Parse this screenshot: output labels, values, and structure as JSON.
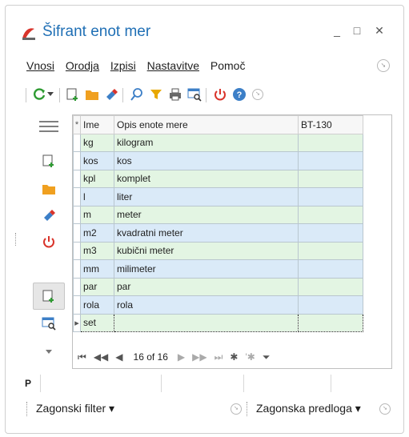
{
  "window": {
    "title": "Šifrant enot mer",
    "minimize": "_",
    "maximize": "□",
    "close": "✕"
  },
  "menu": {
    "items": [
      "Vnosi",
      "Orodja",
      "Izpisi",
      "Nastavitve",
      "Pomoč"
    ]
  },
  "toolbar": {
    "icons": [
      "refresh-icon",
      "dropdown-arrow-icon",
      "new-document-icon",
      "open-folder-icon",
      "eraser-icon",
      "search-icon",
      "filter-icon",
      "print-icon",
      "table-search-icon",
      "power-icon",
      "help-icon",
      "overflow-icon"
    ],
    "colors": {
      "green": "#2e9b32",
      "orange": "#f0a020",
      "red": "#d9342b",
      "blue": "#3c7fc7",
      "yellow": "#e8a800"
    }
  },
  "sidebar": {
    "icons": [
      "hamburger-icon",
      "new-record-icon",
      "open-folder-icon",
      "eraser-icon",
      "power-icon",
      "new-record-selected-icon",
      "table-search-icon",
      "collapse-arrow-icon"
    ]
  },
  "grid": {
    "columns": [
      "Ime",
      "Opis enote mere",
      "BT-130"
    ],
    "header_marker": "*",
    "rows": [
      {
        "ime": "kg",
        "opis": "kilogram",
        "bt": ""
      },
      {
        "ime": "kos",
        "opis": "kos",
        "bt": ""
      },
      {
        "ime": "kpl",
        "opis": "komplet",
        "bt": ""
      },
      {
        "ime": "l",
        "opis": "liter",
        "bt": ""
      },
      {
        "ime": "m",
        "opis": "meter",
        "bt": ""
      },
      {
        "ime": "m2",
        "opis": "kvadratni meter",
        "bt": ""
      },
      {
        "ime": "m3",
        "opis": "kubični meter",
        "bt": ""
      },
      {
        "ime": "mm",
        "opis": "milimeter",
        "bt": ""
      },
      {
        "ime": "par",
        "opis": "par",
        "bt": ""
      },
      {
        "ime": "rola",
        "opis": "rola",
        "bt": ""
      },
      {
        "ime": "set",
        "opis": "",
        "bt": ""
      }
    ],
    "current_row_marker": "▸",
    "row_colors": {
      "green": "#e3f5e3",
      "blue": "#daeaf8"
    }
  },
  "navigator": {
    "first": "⏮",
    "prev_page": "◀◀",
    "prev": "◀",
    "position": "16 of 16",
    "next": "▶",
    "next_page": "▶▶",
    "last": "⏭",
    "append": "✱",
    "delete": "'✱",
    "filter": "⏷"
  },
  "statusbar": {
    "first_cell": "P"
  },
  "bottom": {
    "filter_label": "Zagonski filter ▾",
    "template_label": "Zagonska predloga ▾"
  }
}
